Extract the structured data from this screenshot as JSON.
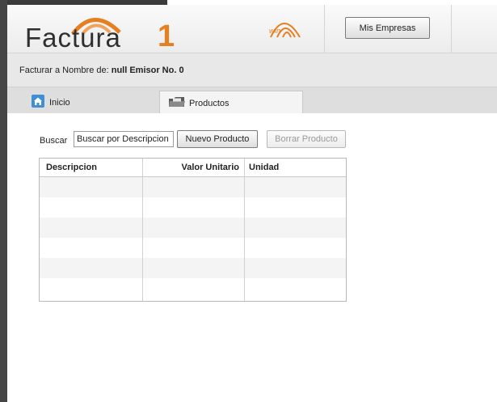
{
  "app": {
    "logo_text": "Factura",
    "logo_digit": "1",
    "brand_mark_label": "wfn"
  },
  "header": {
    "mis_empresas_label": "Mis Empresas"
  },
  "info_bar": {
    "prefix": "Facturar a Nombre de: ",
    "value": "null Emisor No. 0"
  },
  "tabs": [
    {
      "label": "Inicio",
      "icon": "home-icon"
    },
    {
      "label": "Productos",
      "icon": "folder-icon"
    }
  ],
  "search": {
    "label": "Buscar",
    "placeholder": "Buscar por Descripcion",
    "value": ""
  },
  "actions": {
    "nuevo_label": "Nuevo Producto",
    "borrar_label": "Borrar Producto"
  },
  "table": {
    "columns": [
      "Descripcion",
      "Valor Unitario",
      "Unidad"
    ],
    "rows": [
      [
        "",
        "",
        ""
      ],
      [
        "",
        "",
        ""
      ],
      [
        "",
        "",
        ""
      ],
      [
        "",
        "",
        ""
      ],
      [
        "",
        "",
        ""
      ],
      [
        "",
        "",
        ""
      ]
    ]
  },
  "colors": {
    "accent": "#e67e22",
    "header_bg": "#f2f2f2",
    "info_bar_bg": "#e8e8e8"
  }
}
